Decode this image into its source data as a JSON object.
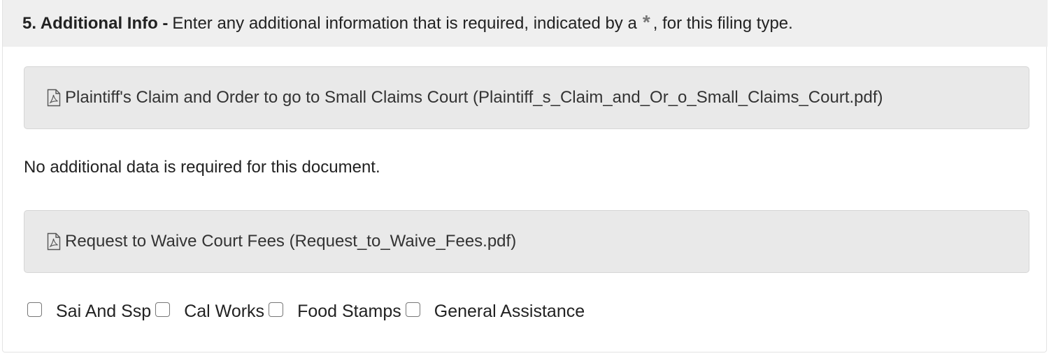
{
  "header": {
    "step_title": "5. Additional Info -",
    "instruction_before": "Enter any additional information that is required, indicated by a",
    "required_marker": "*",
    "instruction_after": ", for this filing type."
  },
  "documents": [
    {
      "icon": "pdf-file-icon",
      "label": "Plaintiff's Claim and Order to go to Small Claims Court (Plaintiff_s_Claim_and_Or_o_Small_Claims_Court.pdf)"
    },
    {
      "icon": "pdf-file-icon",
      "label": "Request to Waive Court Fees (Request_to_Waive_Fees.pdf)"
    }
  ],
  "no_data_message": "No additional data is required for this document.",
  "checkboxes": [
    {
      "label": "Sai And Ssp",
      "checked": false
    },
    {
      "label": "Cal Works",
      "checked": false
    },
    {
      "label": "Food Stamps",
      "checked": false
    },
    {
      "label": "General Assistance",
      "checked": false
    }
  ],
  "colors": {
    "header_bg": "#efefef",
    "doc_box_bg": "#e9e9e9",
    "text": "#222222"
  }
}
